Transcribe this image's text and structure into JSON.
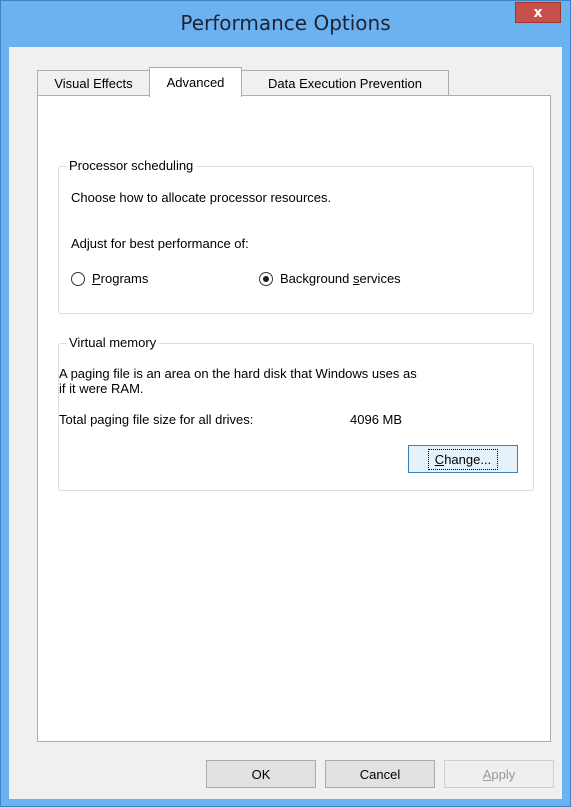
{
  "window": {
    "title": "Performance Options",
    "close_label": "x"
  },
  "tabs": [
    {
      "label": "Visual Effects",
      "active": false
    },
    {
      "label": "Advanced",
      "active": true
    },
    {
      "label": "Data Execution Prevention",
      "active": false
    }
  ],
  "processor": {
    "legend": "Processor scheduling",
    "description": "Choose how to allocate processor resources.",
    "adjust_label": "Adjust for best performance of:",
    "programs": {
      "prefix": "",
      "accel": "P",
      "rest": "rograms",
      "checked": false
    },
    "background": {
      "prefix": "Background ",
      "accel": "s",
      "rest": "ervices",
      "checked": true
    }
  },
  "virtual_memory": {
    "legend": "Virtual memory",
    "description_line1": "A paging file is an area on the hard disk that Windows uses as",
    "description_line2": "if it were RAM.",
    "total_label": "Total paging file size for all drives:",
    "total_value": "4096 MB",
    "change": {
      "accel": "C",
      "rest": "hange..."
    }
  },
  "footer": {
    "ok": "OK",
    "cancel": "Cancel",
    "apply": {
      "accel": "A",
      "rest": "pply"
    }
  }
}
